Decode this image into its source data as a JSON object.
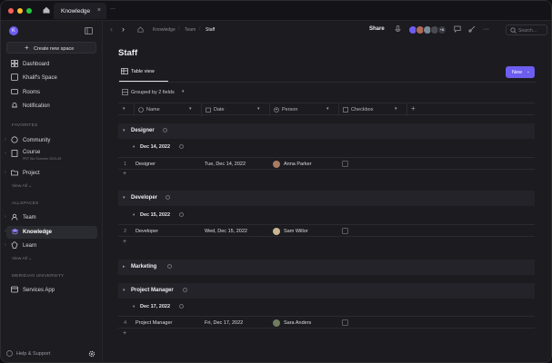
{
  "window": {
    "tab_title": "Knowledge",
    "tab_close": "×",
    "more": "···"
  },
  "sidebar": {
    "workspace_initial": "K",
    "create_label": "Create new space",
    "main_items": [
      {
        "label": "Dashboard",
        "icon": "dashboard-icon"
      },
      {
        "label": "Khalif's Space",
        "icon": "space-icon"
      },
      {
        "label": "Rooms",
        "icon": "rooms-icon"
      },
      {
        "label": "Notification",
        "icon": "bell-icon"
      }
    ],
    "favorites_heading": "FAVORITES",
    "favorites": [
      {
        "label": "Community"
      },
      {
        "label": "Course",
        "sub": "PRT Wo Summer 2023-45"
      },
      {
        "label": "Project"
      }
    ],
    "view_all_1": "View All",
    "allspaces_heading": "ALLSPACES",
    "allspaces": [
      {
        "label": "Team"
      },
      {
        "label": "Knowledge"
      },
      {
        "label": "Learn"
      }
    ],
    "view_all_2": "View All",
    "meridian_heading": "MERIDIAN UNIVERSITY",
    "meridian": [
      {
        "label": "Services App"
      }
    ],
    "help_label": "Help & Support"
  },
  "topbar": {
    "crumbs": [
      "Knowledge",
      "Team",
      "Staff"
    ],
    "share": "Share",
    "avatar_count": "+8",
    "search_placeholder": "Search..."
  },
  "page": {
    "title": "Staff",
    "view_tab": "Table view",
    "new_label": "New",
    "grouped_label": "Grouped by 2 fields"
  },
  "columns": [
    "Name",
    "Date",
    "Person",
    "Checkbox"
  ],
  "groups": [
    {
      "title": "Designer",
      "subgroup": "Dec 14, 2022",
      "row": {
        "num": "1",
        "name": "Designer",
        "date": "Tue, Dec 14, 2022",
        "person": "Anna Parker"
      }
    },
    {
      "title": "Developer",
      "subgroup": "Dec 15, 2022",
      "row": {
        "num": "2",
        "name": "Developer",
        "date": "Wed, Dec 15, 2022",
        "person": "Sam Willor"
      }
    },
    {
      "title": "Marketing"
    },
    {
      "title": "Project Manager",
      "subgroup": "Dec 17, 2022",
      "row": {
        "num": "4",
        "name": "Project Manager",
        "date": "Fri, Dec 17, 2022",
        "person": "Sara Anders"
      }
    }
  ],
  "colors": {
    "accent": "#6d5df0",
    "traffic_red": "#fe5f57",
    "traffic_yellow": "#febc2e",
    "traffic_green": "#28c840"
  }
}
